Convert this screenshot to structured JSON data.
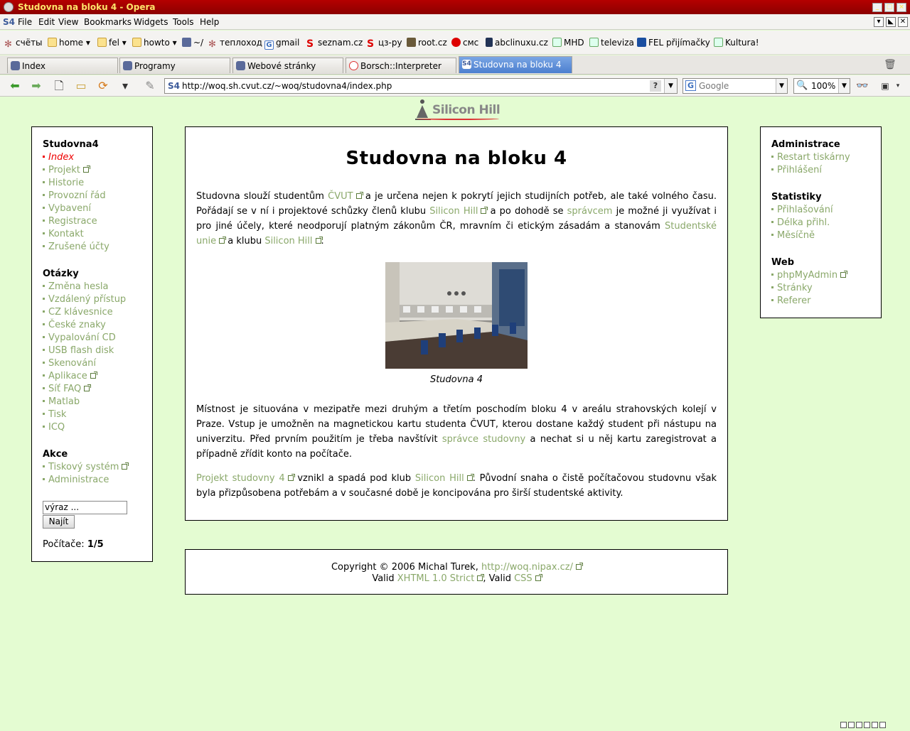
{
  "window": {
    "title": "Studovna na bloku 4 - Opera"
  },
  "menu": {
    "items": [
      "File",
      "Edit",
      "View",
      "Bookmarks",
      "Widgets",
      "Tools",
      "Help"
    ],
    "s4": "S4"
  },
  "bookmarks": [
    "счёты",
    "home",
    "fel",
    "howto",
    "~/",
    "теплоход",
    "gmail",
    "seznam.cz",
    "цз-ру",
    "root.cz",
    "смс",
    "abclinuxu.cz",
    "MHD",
    "televiza",
    "FEL přijímačky",
    "Kultura!"
  ],
  "tabs": [
    "Index",
    "Programy",
    "Webové stránky",
    "Borsch::Interpreter",
    "Studovna na bloku 4"
  ],
  "nav": {
    "url": "http://woq.sh.cvut.cz/~woq/studovna4/index.php",
    "search_placeholder": "Google",
    "zoom": "100%",
    "s4": "S4"
  },
  "logo": {
    "text": "Silicon Hill"
  },
  "left_sidebar": {
    "sections": [
      {
        "title": "Studovna4",
        "items": [
          "Index",
          "Projekt",
          "Historie",
          "Provozní řád",
          "Vybavení",
          "Registrace",
          "Kontakt",
          "Zrušené účty"
        ]
      },
      {
        "title": "Otázky",
        "items": [
          "Změna hesla",
          "Vzdálený přístup",
          "CZ klávesnice",
          "České znaky",
          "Vypalování CD",
          "USB flash disk",
          "Skenování",
          "Aplikace",
          "Síť FAQ",
          "Matlab",
          "Tisk",
          "ICQ"
        ]
      },
      {
        "title": "Akce",
        "items": [
          "Tiskový systém",
          "Administrace"
        ]
      }
    ],
    "search_value": "výraz ...",
    "search_button": "Najít",
    "computers_label": "Počítače:",
    "computers_value": "1/5"
  },
  "right_sidebar": {
    "sections": [
      {
        "title": "Administrace",
        "items": [
          "Restart tiskárny",
          "Přihlášení"
        ]
      },
      {
        "title": "Statistiky",
        "items": [
          "Přihlašování",
          "Délka přihl.",
          "Měsíčně"
        ]
      },
      {
        "title": "Web",
        "items": [
          "phpMyAdmin",
          "Stránky",
          "Referer"
        ]
      }
    ]
  },
  "main": {
    "title": "Studovna na bloku 4",
    "p1": {
      "t1": "Studovna slouží studentům ",
      "l1": "ČVUT",
      "t2": " a je určena nejen k pokrytí jejich studijních potřeb, ale také volného času. Pořádají se v ní i projektové schůzky členů klubu ",
      "l2": "Silicon Hill",
      "t3": " a po dohodě se ",
      "l3": "správcem",
      "t4": " je možné ji využívat i pro jiné účely, které neodporují platným zákonům ČR, mravním či etickým zásadám a stanovám ",
      "l4": "Studentské unie",
      "t5": " a klubu ",
      "l5": "Silicon Hill",
      "t6": "."
    },
    "caption": "Studovna 4",
    "p2": {
      "t1": "Místnost je situována v mezipatře mezi druhým a třetím poschodím bloku 4 v areálu strahovských kolejí v Praze. Vstup je umožněn na magnetickou kartu studenta ČVUT, kterou dostane každý student při nástupu na univerzitu. Před prvním použitím je třeba navštívit ",
      "l1": "správce studovny",
      "t2": " a nechat si u něj kartu zaregistrovat a případně zřídit konto na počítače."
    },
    "p3": {
      "l1": "Projekt studovny 4",
      "t1": " vznikl a spadá pod klub ",
      "l2": "Silicon Hill",
      "t2": ". Původní snaha o čistě počítačovou studovnu však byla přizpůsobena potřebám a v současné době je koncipována pro širší studentské aktivity."
    }
  },
  "footer": {
    "copy": "Copyright © 2006 Michal Turek, ",
    "copy_link": "http://woq.nipax.cz/",
    "valid1": "Valid ",
    "valid_link1": "XHTML 1.0 Strict",
    "valid2": ", Valid ",
    "valid_link2": "CSS"
  },
  "colors": {
    "link": "#8aa86a",
    "current": "#ee0000",
    "page_bg": "#e4fcd2",
    "titlebar": "#a00000"
  }
}
